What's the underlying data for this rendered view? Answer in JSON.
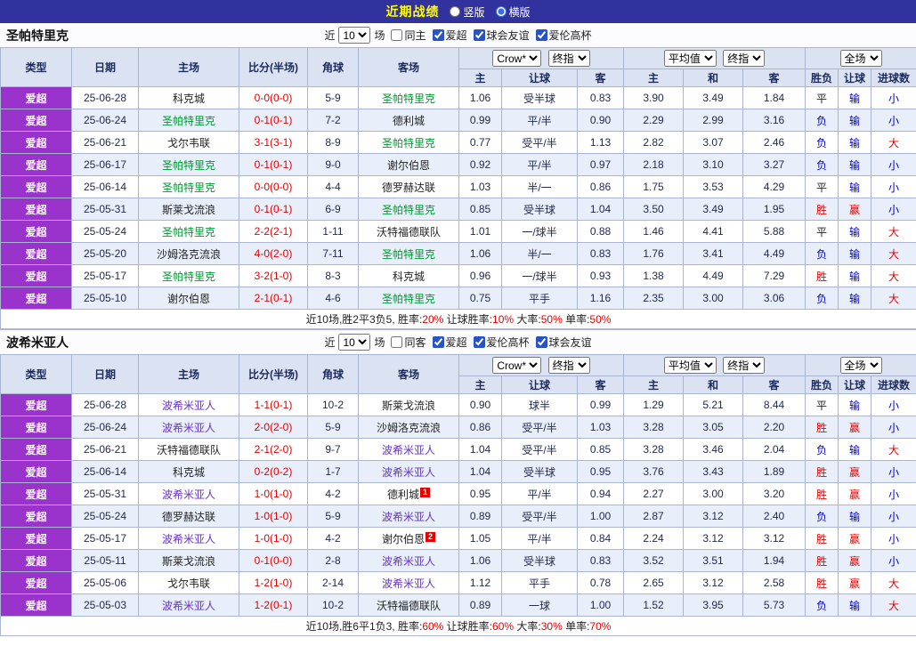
{
  "topbar": {
    "title": "近期战绩",
    "vertical": {
      "label": "竖版",
      "selected": false
    },
    "horizontal": {
      "label": "横版",
      "selected": true
    }
  },
  "result_colors": {
    "胜": "#e60000",
    "平": "#222222",
    "负": "#0000cc",
    "赢": "#e60000",
    "输": "#0000cc",
    "大": "#e60000",
    "小": "#0000cc"
  },
  "sections": [
    {
      "team": "圣帕特里克",
      "team_color": "#009933",
      "filter": {
        "prefix": "近",
        "count": "10",
        "suffix": "场",
        "checkboxes": [
          {
            "label": "同主",
            "checked": false
          },
          {
            "label": "爱超",
            "checked": true
          },
          {
            "label": "球会友谊",
            "checked": true
          },
          {
            "label": "爱伦高杯",
            "checked": true
          }
        ]
      },
      "header": {
        "type": "类型",
        "date": "日期",
        "home": "主场",
        "score": "比分(半场)",
        "corner": "角球",
        "away": "客场",
        "book_dd": "Crow*",
        "final_dd": "终指",
        "avg_dd": "平均值",
        "final2_dd": "终指",
        "scope_dd": "全场",
        "sub": [
          "主",
          "让球",
          "客",
          "主",
          "和",
          "客",
          "胜负",
          "让球",
          "进球数"
        ]
      },
      "rows": [
        {
          "type": "爱超",
          "date": "25-06-28",
          "home": "科克城",
          "score": "0-0(0-0)",
          "corner": "5-9",
          "away": "圣帕特里克",
          "away_hl": true,
          "h": "1.06",
          "handicap": "受半球",
          "a": "0.83",
          "o1": "3.90",
          "o2": "3.49",
          "o3": "1.84",
          "r1": "平",
          "r2": "输",
          "r3": "小"
        },
        {
          "type": "爱超",
          "date": "25-06-24",
          "home": "圣帕特里克",
          "home_hl": true,
          "score": "0-1(0-1)",
          "corner": "7-2",
          "away": "德利城",
          "h": "0.99",
          "handicap": "平/半",
          "a": "0.90",
          "o1": "2.29",
          "o2": "2.99",
          "o3": "3.16",
          "r1": "负",
          "r2": "输",
          "r3": "小"
        },
        {
          "type": "爱超",
          "date": "25-06-21",
          "home": "戈尔韦联",
          "score": "3-1(3-1)",
          "corner": "8-9",
          "away": "圣帕特里克",
          "away_hl": true,
          "h": "0.77",
          "handicap": "受平/半",
          "a": "1.13",
          "o1": "2.82",
          "o2": "3.07",
          "o3": "2.46",
          "r1": "负",
          "r2": "输",
          "r3": "大"
        },
        {
          "type": "爱超",
          "date": "25-06-17",
          "home": "圣帕特里克",
          "home_hl": true,
          "score": "0-1(0-1)",
          "corner": "9-0",
          "away": "谢尔伯恩",
          "h": "0.92",
          "handicap": "平/半",
          "a": "0.97",
          "o1": "2.18",
          "o2": "3.10",
          "o3": "3.27",
          "r1": "负",
          "r2": "输",
          "r3": "小"
        },
        {
          "type": "爱超",
          "date": "25-06-14",
          "home": "圣帕特里克",
          "home_hl": true,
          "score": "0-0(0-0)",
          "corner": "4-4",
          "away": "德罗赫达联",
          "h": "1.03",
          "handicap": "半/一",
          "a": "0.86",
          "o1": "1.75",
          "o2": "3.53",
          "o3": "4.29",
          "r1": "平",
          "r2": "输",
          "r3": "小"
        },
        {
          "type": "爱超",
          "date": "25-05-31",
          "home": "斯莱戈流浪",
          "score": "0-1(0-1)",
          "corner": "6-9",
          "away": "圣帕特里克",
          "away_hl": true,
          "h": "0.85",
          "handicap": "受半球",
          "a": "1.04",
          "o1": "3.50",
          "o2": "3.49",
          "o3": "1.95",
          "r1": "胜",
          "r2": "赢",
          "r3": "小"
        },
        {
          "type": "爱超",
          "date": "25-05-24",
          "home": "圣帕特里克",
          "home_hl": true,
          "score": "2-2(2-1)",
          "corner": "1-11",
          "away": "沃特福德联队",
          "h": "1.01",
          "handicap": "一/球半",
          "a": "0.88",
          "o1": "1.46",
          "o2": "4.41",
          "o3": "5.88",
          "r1": "平",
          "r2": "输",
          "r3": "大"
        },
        {
          "type": "爱超",
          "date": "25-05-20",
          "home": "沙姆洛克流浪",
          "score": "4-0(2-0)",
          "corner": "7-11",
          "away": "圣帕特里克",
          "away_hl": true,
          "h": "1.06",
          "handicap": "半/一",
          "a": "0.83",
          "o1": "1.76",
          "o2": "3.41",
          "o3": "4.49",
          "r1": "负",
          "r2": "输",
          "r3": "大"
        },
        {
          "type": "爱超",
          "date": "25-05-17",
          "home": "圣帕特里克",
          "home_hl": true,
          "score": "3-2(1-0)",
          "corner": "8-3",
          "away": "科克城",
          "h": "0.96",
          "handicap": "一/球半",
          "a": "0.93",
          "o1": "1.38",
          "o2": "4.49",
          "o3": "7.29",
          "r1": "胜",
          "r2": "输",
          "r3": "大"
        },
        {
          "type": "爱超",
          "date": "25-05-10",
          "home": "谢尔伯恩",
          "score": "2-1(0-1)",
          "corner": "4-6",
          "away": "圣帕特里克",
          "away_hl": true,
          "h": "0.75",
          "handicap": "平手",
          "a": "1.16",
          "o1": "2.35",
          "o2": "3.00",
          "o3": "3.06",
          "r1": "负",
          "r2": "输",
          "r3": "大"
        }
      ],
      "summary": {
        "lead": "近10场,胜2平3负5,",
        "stats": [
          {
            "label": " 胜率:",
            "value": "20%"
          },
          {
            "label": " 让球胜率:",
            "value": "10%"
          },
          {
            "label": " 大率:",
            "value": "50%"
          },
          {
            "label": " 单率:",
            "value": "50%"
          }
        ]
      }
    },
    {
      "team": "波希米亚人",
      "team_color": "#6633cc",
      "filter": {
        "prefix": "近",
        "count": "10",
        "suffix": "场",
        "checkboxes": [
          {
            "label": "同客",
            "checked": false
          },
          {
            "label": "爱超",
            "checked": true
          },
          {
            "label": "爱伦高杯",
            "checked": true
          },
          {
            "label": "球会友谊",
            "checked": true
          }
        ]
      },
      "header": {
        "type": "类型",
        "date": "日期",
        "home": "主场",
        "score": "比分(半场)",
        "corner": "角球",
        "away": "客场",
        "book_dd": "Crow*",
        "final_dd": "终指",
        "avg_dd": "平均值",
        "final2_dd": "终指",
        "scope_dd": "全场",
        "sub": [
          "主",
          "让球",
          "客",
          "主",
          "和",
          "客",
          "胜负",
          "让球",
          "进球数"
        ]
      },
      "rows": [
        {
          "type": "爱超",
          "date": "25-06-28",
          "home": "波希米亚人",
          "home_hl": true,
          "score": "1-1(0-1)",
          "corner": "10-2",
          "away": "斯莱戈流浪",
          "h": "0.90",
          "handicap": "球半",
          "a": "0.99",
          "o1": "1.29",
          "o2": "5.21",
          "o3": "8.44",
          "r1": "平",
          "r2": "输",
          "r3": "小"
        },
        {
          "type": "爱超",
          "date": "25-06-24",
          "home": "波希米亚人",
          "home_hl": true,
          "score": "2-0(2-0)",
          "corner": "5-9",
          "away": "沙姆洛克流浪",
          "h": "0.86",
          "handicap": "受平/半",
          "a": "1.03",
          "o1": "3.28",
          "o2": "3.05",
          "o3": "2.20",
          "r1": "胜",
          "r2": "赢",
          "r3": "小"
        },
        {
          "type": "爱超",
          "date": "25-06-21",
          "home": "沃特福德联队",
          "score": "2-1(2-0)",
          "corner": "9-7",
          "away": "波希米亚人",
          "away_hl": true,
          "h": "1.04",
          "handicap": "受平/半",
          "a": "0.85",
          "o1": "3.28",
          "o2": "3.46",
          "o3": "2.04",
          "r1": "负",
          "r2": "输",
          "r3": "大"
        },
        {
          "type": "爱超",
          "date": "25-06-14",
          "home": "科克城",
          "score": "0-2(0-2)",
          "corner": "1-7",
          "away": "波希米亚人",
          "away_hl": true,
          "h": "1.04",
          "handicap": "受半球",
          "a": "0.95",
          "o1": "3.76",
          "o2": "3.43",
          "o3": "1.89",
          "r1": "胜",
          "r2": "赢",
          "r3": "小"
        },
        {
          "type": "爱超",
          "date": "25-05-31",
          "home": "波希米亚人",
          "home_hl": true,
          "score": "1-0(1-0)",
          "corner": "4-2",
          "away": "德利城",
          "away_badge": "1",
          "h": "0.95",
          "handicap": "平/半",
          "a": "0.94",
          "o1": "2.27",
          "o2": "3.00",
          "o3": "3.20",
          "r1": "胜",
          "r2": "赢",
          "r3": "小"
        },
        {
          "type": "爱超",
          "date": "25-05-24",
          "home": "德罗赫达联",
          "score": "1-0(1-0)",
          "corner": "5-9",
          "away": "波希米亚人",
          "away_hl": true,
          "h": "0.89",
          "handicap": "受平/半",
          "a": "1.00",
          "o1": "2.87",
          "o2": "3.12",
          "o3": "2.40",
          "r1": "负",
          "r2": "输",
          "r3": "小"
        },
        {
          "type": "爱超",
          "date": "25-05-17",
          "home": "波希米亚人",
          "home_hl": true,
          "score": "1-0(1-0)",
          "corner": "4-2",
          "away": "谢尔伯恩",
          "away_badge": "2",
          "h": "1.05",
          "handicap": "平/半",
          "a": "0.84",
          "o1": "2.24",
          "o2": "3.12",
          "o3": "3.12",
          "r1": "胜",
          "r2": "赢",
          "r3": "小"
        },
        {
          "type": "爱超",
          "date": "25-05-11",
          "home": "斯莱戈流浪",
          "score": "0-1(0-0)",
          "corner": "2-8",
          "away": "波希米亚人",
          "away_hl": true,
          "h": "1.06",
          "handicap": "受半球",
          "a": "0.83",
          "o1": "3.52",
          "o2": "3.51",
          "o3": "1.94",
          "r1": "胜",
          "r2": "赢",
          "r3": "小"
        },
        {
          "type": "爱超",
          "date": "25-05-06",
          "home": "戈尔韦联",
          "score": "1-2(1-0)",
          "corner": "2-14",
          "away": "波希米亚人",
          "away_hl": true,
          "h": "1.12",
          "handicap": "平手",
          "a": "0.78",
          "o1": "2.65",
          "o2": "3.12",
          "o3": "2.58",
          "r1": "胜",
          "r2": "赢",
          "r3": "大"
        },
        {
          "type": "爱超",
          "date": "25-05-03",
          "home": "波希米亚人",
          "home_hl": true,
          "score": "1-2(0-1)",
          "corner": "10-2",
          "away": "沃特福德联队",
          "h": "0.89",
          "handicap": "一球",
          "a": "1.00",
          "o1": "1.52",
          "o2": "3.95",
          "o3": "5.73",
          "r1": "负",
          "r2": "输",
          "r3": "大"
        }
      ],
      "summary": {
        "lead": "近10场,胜6平1负3,",
        "stats": [
          {
            "label": " 胜率:",
            "value": "60%"
          },
          {
            "label": " 让球胜率:",
            "value": "60%"
          },
          {
            "label": " 大率:",
            "value": "30%"
          },
          {
            "label": " 单率:",
            "value": "70%"
          }
        ]
      }
    }
  ]
}
